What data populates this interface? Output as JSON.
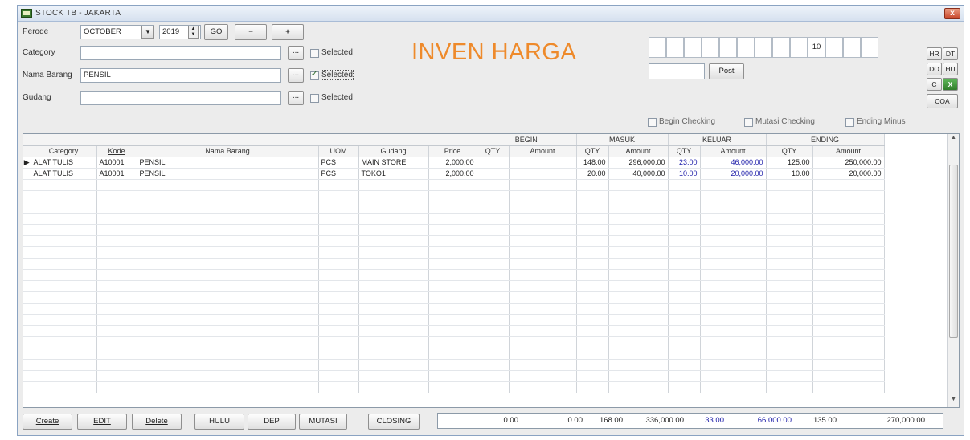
{
  "window": {
    "title": "STOCK TB - JAKARTA",
    "close_label": "x"
  },
  "filters": {
    "periode_label": "Perode",
    "month": "OCTOBER",
    "year": "2019",
    "go_label": "GO",
    "minus_label": "−",
    "plus_label": "+",
    "category_label": "Category",
    "category_value": "",
    "nama_barang_label": "Nama Barang",
    "nama_barang_value": "PENSIL",
    "gudang_label": "Gudang",
    "gudang_value": "",
    "browse_label": "...",
    "selected_label": "Selected"
  },
  "page_title": "INVEN HARGA",
  "top_right": {
    "box_value": "10",
    "post_label": "Post",
    "buttons": [
      "HR",
      "DT",
      "DO",
      "HU",
      "C",
      "COA"
    ]
  },
  "checks": {
    "begin": "Begin Checking",
    "mutasi": "Mutasi Checking",
    "ending": "Ending Minus"
  },
  "grid": {
    "groups": {
      "begin": "BEGIN",
      "masuk": "MASUK",
      "keluar": "KELUAR",
      "ending": "ENDING"
    },
    "columns": [
      "Category",
      "Kode",
      "Nama Barang",
      "UOM",
      "Gudang",
      "Price",
      "QTY",
      "Amount",
      "QTY",
      "Amount",
      "QTY",
      "Amount",
      "QTY",
      "Amount"
    ],
    "rows": [
      [
        "ALAT TULIS",
        "A10001",
        "PENSIL",
        "PCS",
        "MAIN STORE",
        "2,000.00",
        "",
        "",
        "148.00",
        "296,000.00",
        "23.00",
        "46,000.00",
        "125.00",
        "250,000.00"
      ],
      [
        "ALAT TULIS",
        "A10001",
        "PENSIL",
        "PCS",
        "TOKO1",
        "2,000.00",
        "",
        "",
        "20.00",
        "40,000.00",
        "10.00",
        "20,000.00",
        "10.00",
        "20,000.00"
      ]
    ]
  },
  "footer": {
    "buttons": [
      "Create",
      "EDIT",
      "Delete",
      "HULU",
      "DEP",
      "MUTASI",
      "CLOSING"
    ],
    "totals": [
      "0.00",
      "0.00",
      "168.00",
      "336,000.00",
      "33.00",
      "66,000.00",
      "135.00",
      "270,000.00"
    ]
  }
}
